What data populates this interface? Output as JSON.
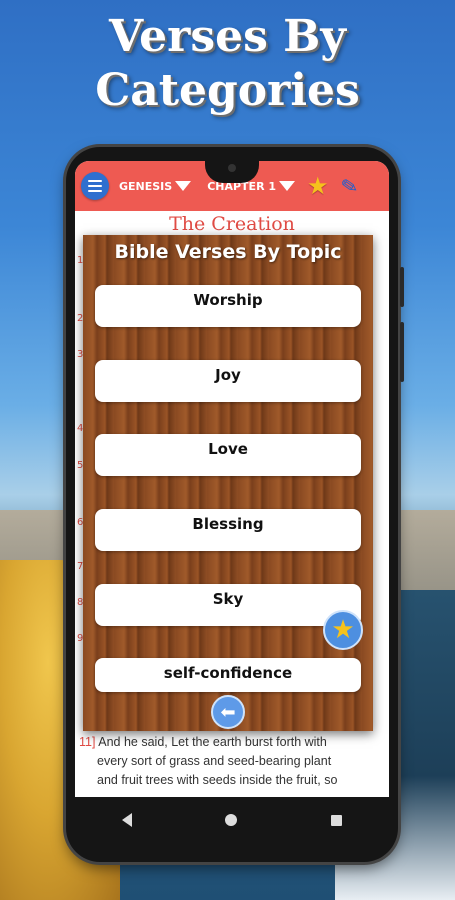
{
  "headline": {
    "line1": "Verses By",
    "line2": "Categories"
  },
  "appbar": {
    "book": "GENESIS",
    "chapter": "CHAPTER 1",
    "favorites_icon": "star-icon",
    "edit_icon": "pen-icon",
    "menu_icon": "hamburger-icon"
  },
  "chapter_title": "The Creation",
  "dialog": {
    "title": "Bible Verses By Topic",
    "topics": [
      "Worship",
      "Joy",
      "Love",
      "Blessing",
      "Sky",
      "self-confidence"
    ],
    "favorite_icon": "star-icon",
    "back_icon": "arrow-left-icon"
  },
  "verse": {
    "number": "11]",
    "line1": "And he said, Let the earth burst forth with",
    "line2": "every sort of grass and seed-bearing plant",
    "line3": "and fruit trees with seeds inside the fruit, so"
  },
  "side_numbers": [
    "1",
    "2",
    "3",
    "4",
    "5",
    "6",
    "7",
    "8",
    "9"
  ],
  "colors": {
    "appbar": "#ee5a52",
    "accent_red": "#e04b44",
    "menu_blue": "#2f6fcf",
    "star": "#f6c21c"
  }
}
